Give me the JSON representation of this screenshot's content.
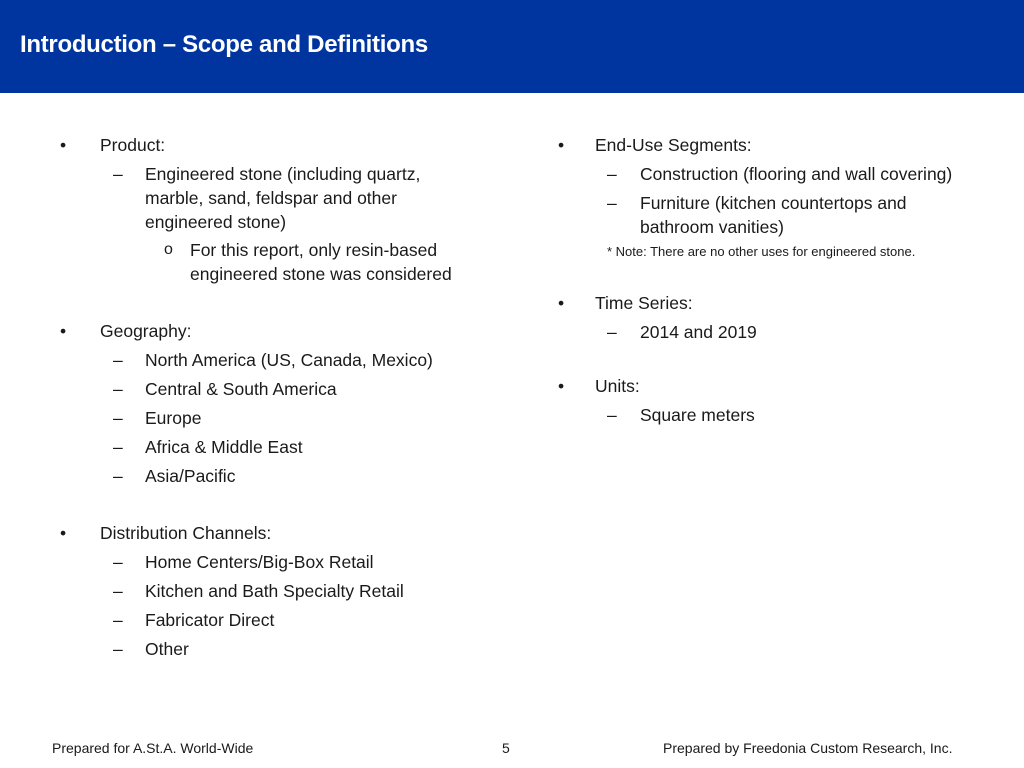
{
  "header": {
    "title": "Introduction – Scope and Definitions",
    "bg_color": "#00359f"
  },
  "left": {
    "product": {
      "label": "Product:",
      "items": [
        {
          "text": "Engineered stone (including quartz, marble, sand, feldspar and other engineered stone)",
          "sub": "For this report, only resin-based engineered stone was considered"
        }
      ]
    },
    "geography": {
      "label": "Geography:",
      "items": [
        "North America (US, Canada, Mexico)",
        "Central & South America",
        "Europe",
        "Africa & Middle East",
        "Asia/Pacific"
      ]
    },
    "distribution": {
      "label": "Distribution Channels:",
      "items": [
        "Home Centers/Big-Box Retail",
        "Kitchen and Bath Specialty Retail",
        "Fabricator Direct",
        "Other"
      ]
    }
  },
  "right": {
    "end_use": {
      "label": "End-Use Segments:",
      "items": [
        "Construction (flooring and wall covering)",
        "Furniture (kitchen countertops and bathroom vanities)"
      ],
      "note": "* Note: There are no other uses for engineered stone."
    },
    "time_series": {
      "label": "Time Series:",
      "items": [
        "2014 and 2019"
      ]
    },
    "units": {
      "label": "Units:",
      "items": [
        "Square meters"
      ]
    }
  },
  "marks": {
    "bullet": "•",
    "dash": "–",
    "circle": "o"
  },
  "footer": {
    "left": "Prepared for A.St.A. World-Wide",
    "page": "5",
    "right": "Prepared by Freedonia Custom Research, Inc."
  }
}
